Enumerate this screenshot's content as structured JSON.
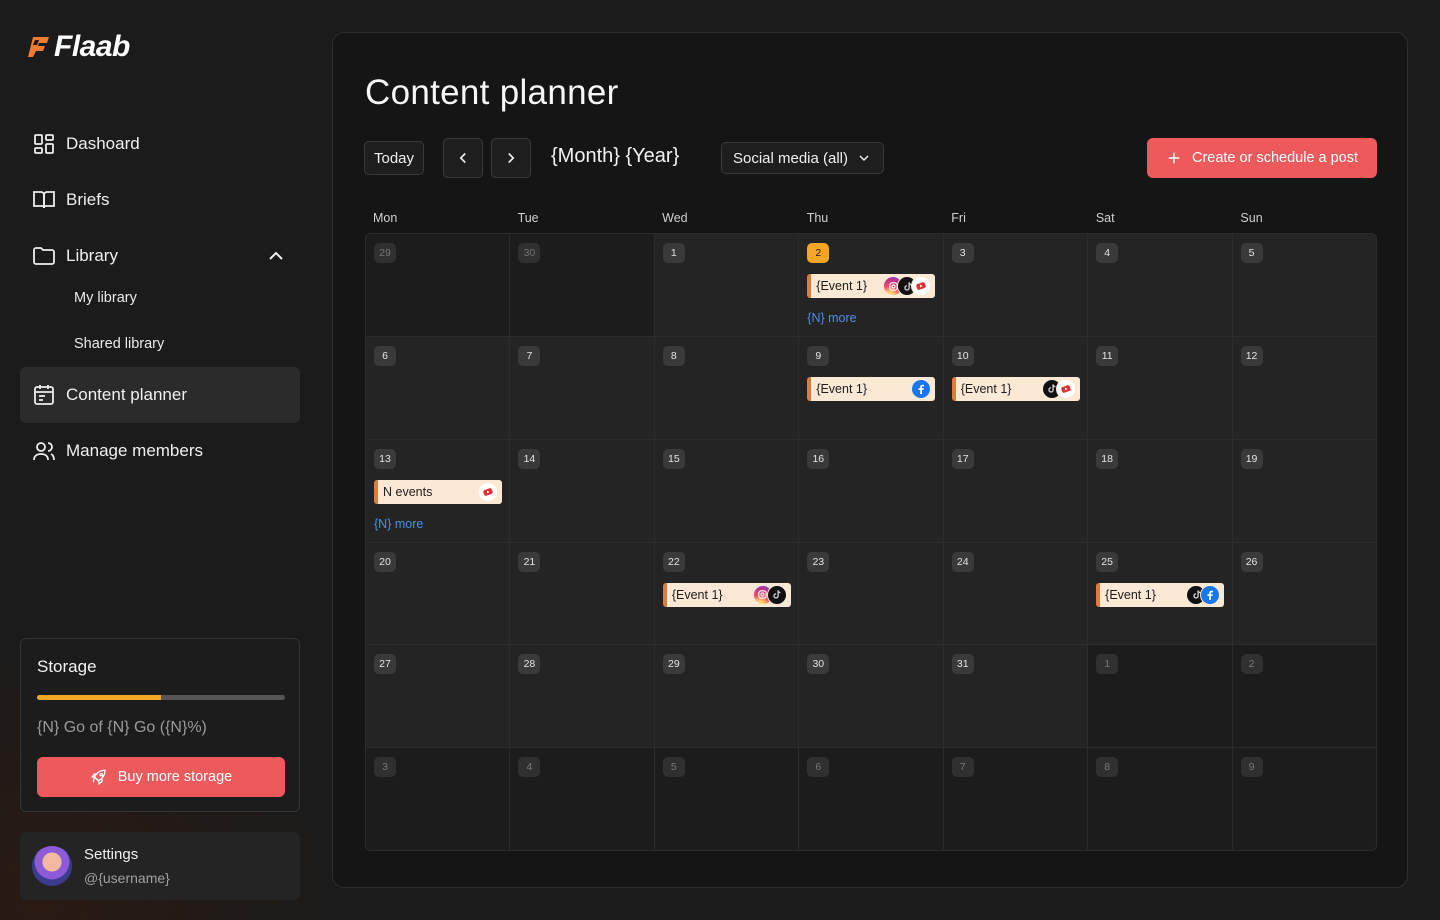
{
  "app": {
    "name": "Flaab"
  },
  "sidebar": {
    "items": [
      {
        "label": "Dashoard",
        "icon": "dashboard-icon"
      },
      {
        "label": "Briefs",
        "icon": "book-icon"
      },
      {
        "label": "Library",
        "icon": "folder-icon"
      },
      {
        "label": "Content planner",
        "icon": "calendar-icon",
        "active": true
      },
      {
        "label": "Manage members",
        "icon": "users-icon"
      }
    ],
    "library_sub": [
      "My library",
      "Shared library"
    ]
  },
  "storage": {
    "title": "Storage",
    "usage_fraction": 0.5,
    "usage_text": "{N} Go of {N} Go ({N}%)",
    "buy_label": "Buy more storage"
  },
  "profile": {
    "name": "Settings",
    "username": "@{username}"
  },
  "main": {
    "title": "Content planner",
    "today_label": "Today",
    "month_label": "{Month} {Year}",
    "filter_label": "Social media (all)",
    "create_label": "Create or schedule a post",
    "weekdays": [
      "Mon",
      "Tue",
      "Wed",
      "Thu",
      "Fri",
      "Sat",
      "Sun"
    ],
    "more_label": "{N} more"
  },
  "calendar": {
    "weeks": [
      [
        {
          "day": "29",
          "muted": true
        },
        {
          "day": "30",
          "muted": true
        },
        {
          "day": "1"
        },
        {
          "day": "2",
          "today": true,
          "event": {
            "label": "{Event 1}",
            "icons": [
              "instagram",
              "tiktok",
              "youtube"
            ]
          },
          "more": true
        },
        {
          "day": "3"
        },
        {
          "day": "4"
        },
        {
          "day": "5"
        }
      ],
      [
        {
          "day": "6"
        },
        {
          "day": "7"
        },
        {
          "day": "8"
        },
        {
          "day": "9",
          "event": {
            "label": "{Event 1}",
            "icons": [
              "facebook"
            ]
          }
        },
        {
          "day": "10",
          "event": {
            "label": "{Event 1}",
            "icons": [
              "tiktok",
              "youtube"
            ]
          }
        },
        {
          "day": "11"
        },
        {
          "day": "12"
        }
      ],
      [
        {
          "day": "13",
          "event": {
            "label": "N events",
            "icons": [
              "youtube"
            ]
          },
          "more": true
        },
        {
          "day": "14"
        },
        {
          "day": "15"
        },
        {
          "day": "16"
        },
        {
          "day": "17"
        },
        {
          "day": "18"
        },
        {
          "day": "19"
        }
      ],
      [
        {
          "day": "20"
        },
        {
          "day": "21"
        },
        {
          "day": "22",
          "event": {
            "label": "{Event 1}",
            "icons": [
              "instagram",
              "tiktok"
            ]
          }
        },
        {
          "day": "23"
        },
        {
          "day": "24"
        },
        {
          "day": "25",
          "event": {
            "label": "{Event 1}",
            "icons": [
              "tiktok",
              "facebook"
            ]
          }
        },
        {
          "day": "26"
        }
      ],
      [
        {
          "day": "27"
        },
        {
          "day": "28"
        },
        {
          "day": "29"
        },
        {
          "day": "30"
        },
        {
          "day": "31"
        },
        {
          "day": "1",
          "muted": true
        },
        {
          "day": "2",
          "muted": true
        }
      ],
      [
        {
          "day": "3",
          "muted": true
        },
        {
          "day": "4",
          "muted": true
        },
        {
          "day": "5",
          "muted": true
        },
        {
          "day": "6",
          "muted": true
        },
        {
          "day": "7",
          "muted": true
        },
        {
          "day": "8",
          "muted": true
        },
        {
          "day": "9",
          "muted": true
        }
      ]
    ]
  },
  "colors": {
    "accent": "#ee5a5c",
    "today": "#f5a623",
    "link": "#4a8ef0"
  }
}
